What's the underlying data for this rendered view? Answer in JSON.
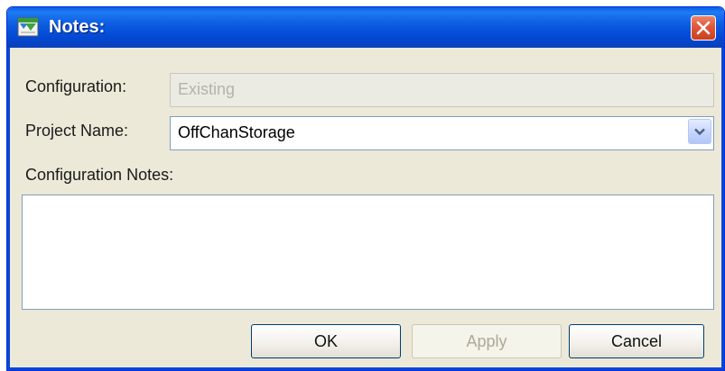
{
  "window": {
    "title": "Notes:"
  },
  "form": {
    "configuration_label": "Configuration:",
    "configuration_value": "Existing",
    "project_name_label": "Project Name:",
    "project_name_value": "OffChanStorage",
    "notes_label": "Configuration Notes:",
    "notes_value": ""
  },
  "buttons": {
    "ok": "OK",
    "apply": "Apply",
    "cancel": "Cancel"
  },
  "icons": {
    "app": "notes-app-icon",
    "close": "close-icon",
    "dropdown": "chevron-down-icon"
  },
  "colors": {
    "titlebar": "#0b5ae0",
    "close_button": "#e2563a",
    "dialog_background": "#ece9d8"
  }
}
